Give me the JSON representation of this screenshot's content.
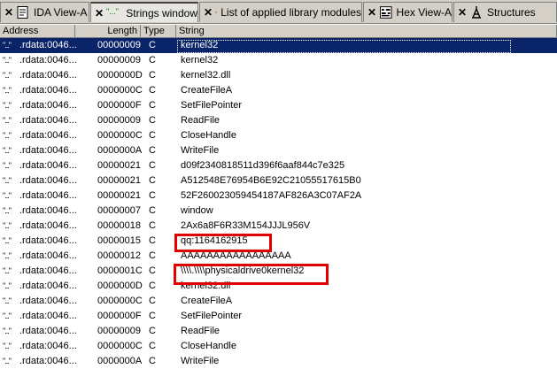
{
  "tabs": [
    {
      "label": "IDA View-A",
      "active": false,
      "icon": "document-icon"
    },
    {
      "label": "Strings window",
      "active": true,
      "icon": "strings-icon",
      "icon_text": "\"...\""
    },
    {
      "label": "List of applied library modules",
      "active": false,
      "icon": "flower-icon"
    },
    {
      "label": "Hex View-A",
      "active": false,
      "icon": "hex-icon"
    },
    {
      "label": "Structures",
      "active": false,
      "icon": "structure-icon"
    }
  ],
  "columns": {
    "address": "Address",
    "length": "Length",
    "type": "Type",
    "string": "String"
  },
  "row_icon": "\"...\"",
  "rows": [
    {
      "address": ".rdata:0046...",
      "length": "00000009",
      "type": "C",
      "string": "kernel32",
      "selected": true
    },
    {
      "address": ".rdata:0046...",
      "length": "00000009",
      "type": "C",
      "string": "kernel32"
    },
    {
      "address": ".rdata:0046...",
      "length": "0000000D",
      "type": "C",
      "string": "kernel32.dll"
    },
    {
      "address": ".rdata:0046...",
      "length": "0000000C",
      "type": "C",
      "string": "CreateFileA"
    },
    {
      "address": ".rdata:0046...",
      "length": "0000000F",
      "type": "C",
      "string": "SetFilePointer"
    },
    {
      "address": ".rdata:0046...",
      "length": "00000009",
      "type": "C",
      "string": "ReadFile"
    },
    {
      "address": ".rdata:0046...",
      "length": "0000000C",
      "type": "C",
      "string": "CloseHandle"
    },
    {
      "address": ".rdata:0046...",
      "length": "0000000A",
      "type": "C",
      "string": "WriteFile"
    },
    {
      "address": ".rdata:0046...",
      "length": "00000021",
      "type": "C",
      "string": "d09f2340818511d396f6aaf844c7e325"
    },
    {
      "address": ".rdata:0046...",
      "length": "00000021",
      "type": "C",
      "string": "A512548E76954B6E92C21055517615B0"
    },
    {
      "address": ".rdata:0046...",
      "length": "00000021",
      "type": "C",
      "string": "52F260023059454187AF826A3C07AF2A"
    },
    {
      "address": ".rdata:0046...",
      "length": "00000007",
      "type": "C",
      "string": "window"
    },
    {
      "address": ".rdata:0046...",
      "length": "00000018",
      "type": "C",
      "string": "2Ax6a8F6R33M154JJJL956V"
    },
    {
      "address": ".rdata:0046...",
      "length": "00000015",
      "type": "C",
      "string": "qq:1164162915",
      "highlight": true
    },
    {
      "address": ".rdata:0046...",
      "length": "00000012",
      "type": "C",
      "string": "AAAAAAAAAAAAAAAAA"
    },
    {
      "address": ".rdata:0046...",
      "length": "0000001C",
      "type": "C",
      "string": "\\\\\\\\.\\\\\\\\physicaldrive0kernel32",
      "highlight": true
    },
    {
      "address": ".rdata:0046...",
      "length": "0000000D",
      "type": "C",
      "string": "kernel32.dll"
    },
    {
      "address": ".rdata:0046...",
      "length": "0000000C",
      "type": "C",
      "string": "CreateFileA"
    },
    {
      "address": ".rdata:0046...",
      "length": "0000000F",
      "type": "C",
      "string": "SetFilePointer"
    },
    {
      "address": ".rdata:0046...",
      "length": "00000009",
      "type": "C",
      "string": "ReadFile"
    },
    {
      "address": ".rdata:0046...",
      "length": "0000000C",
      "type": "C",
      "string": "CloseHandle"
    },
    {
      "address": ".rdata:0046...",
      "length": "0000000A",
      "type": "C",
      "string": "WriteFile"
    }
  ],
  "colors": {
    "selection": "#0a246a",
    "highlight_box": "#e00000",
    "row_icon_dots": "#008000"
  }
}
